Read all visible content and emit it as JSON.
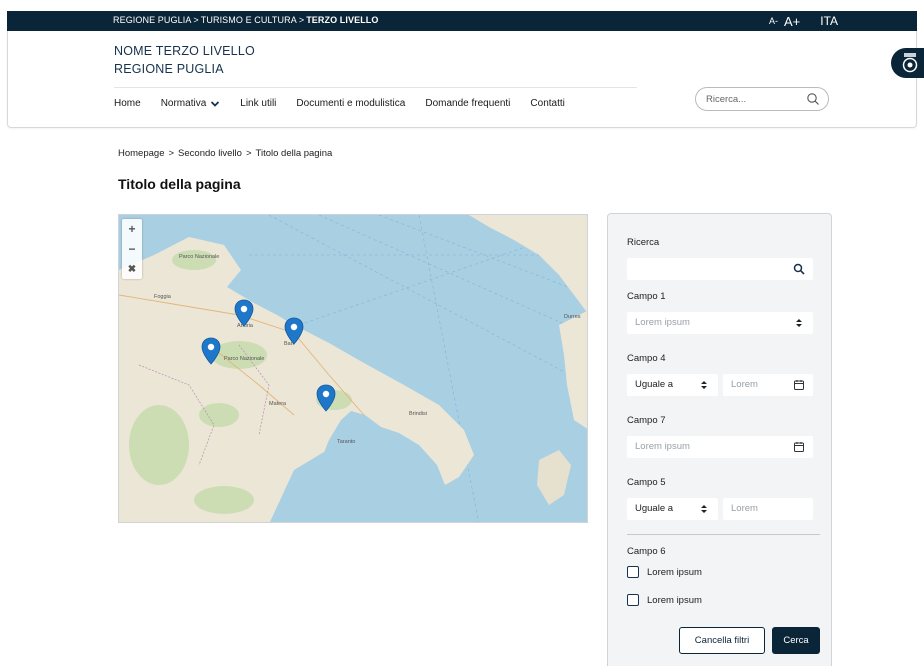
{
  "topbar": {
    "crumb_1": "REGIONE PUGLIA",
    "crumb_2": "TURISMO E CULTURA",
    "crumb_3": "TERZO LIVELLO",
    "separator": ">",
    "font_small": "A-",
    "font_large": "A+",
    "language": "ITA"
  },
  "header": {
    "site_name": "NOME TERZO LIVELLO",
    "site_org": "REGIONE PUGLIA",
    "search_placeholder": "Ricerca..."
  },
  "nav": {
    "items": [
      "Home",
      "Normativa",
      "Link utili",
      "Documenti e modulistica",
      "Domande frequenti",
      "Contatti"
    ]
  },
  "breadcrumb": {
    "items": [
      "Homepage",
      "Secondo livello",
      "Titolo della pagina"
    ],
    "separator": ">"
  },
  "page_title": "Titolo della pagina",
  "map": {
    "zoom_in": "+",
    "zoom_out": "−",
    "reset": "✖"
  },
  "filters": {
    "ricerca_label": "Ricerca",
    "campo1_label": "Campo 1",
    "campo1_placeholder": "Lorem ipsum",
    "campo4_label": "Campo 4",
    "campo4_select": "Uguale a",
    "campo4_placeholder": "Lorem",
    "campo7_label": "Campo 7",
    "campo7_placeholder": "Lorem ipsum",
    "campo5_label": "Campo 5",
    "campo5_select": "Uguale a",
    "campo5_placeholder": "Lorem",
    "campo6_label": "Campo 6",
    "check_1": "Lorem ipsum",
    "check_2": "Lorem ipsum",
    "clear_button": "Cancella filtri",
    "search_button": "Cerca"
  },
  "colors": {
    "brand_dark": "#0b2538",
    "marker": "#1f77c9",
    "sea": "#a9cfe3",
    "land": "#ece6d6"
  }
}
